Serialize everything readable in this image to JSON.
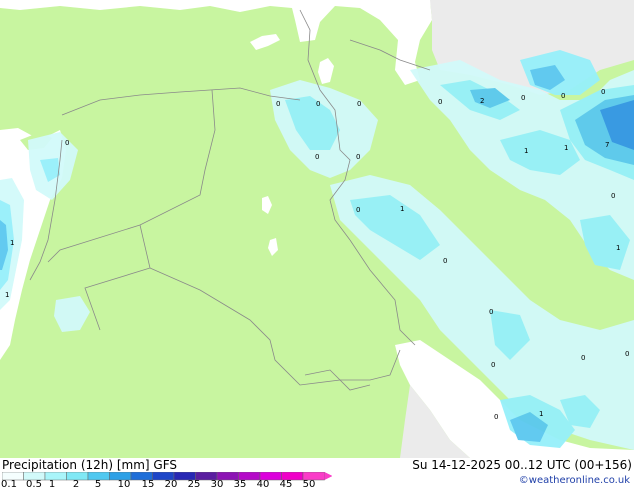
{
  "map": {
    "colors": {
      "land": "#c8f5a0",
      "sea": "#ffffff",
      "grey_land": "#ebebeb",
      "precip_1": "#d2fafa",
      "precip_2": "#96f0fa",
      "precip_3": "#5ac8f0",
      "precip_4": "#3296e6",
      "border": "#8a8a8a"
    },
    "value_labels": [
      "0",
      "0",
      "0",
      "0",
      "0",
      "2",
      "0",
      "0",
      "0",
      "0",
      "1",
      "1",
      "1",
      "7",
      "0",
      "0",
      "1",
      "0",
      "0",
      "1",
      "1",
      "1",
      "0",
      "0",
      "0",
      "0",
      "0",
      "1"
    ]
  },
  "footer": {
    "title": "Precipitation (12h) [mm] GFS",
    "run_info": "Su 14-12-2025 00..12 UTC (00+156)",
    "credit": "©weatheronline.co.uk"
  },
  "legend": {
    "labels": [
      "0.1",
      "0.5",
      "1",
      "2",
      "5",
      "10",
      "15",
      "20",
      "25",
      "30",
      "35",
      "40",
      "45",
      "50"
    ],
    "colors": [
      "#f5fefe",
      "#d2fafa",
      "#aaf5fa",
      "#80e8f5",
      "#50c8f0",
      "#2da0e6",
      "#1e6ed8",
      "#1e46c8",
      "#2828b4",
      "#5a1ea0",
      "#8c14b4",
      "#b40ac8",
      "#dc00dc",
      "#f000c8",
      "#fa3cc8"
    ]
  }
}
